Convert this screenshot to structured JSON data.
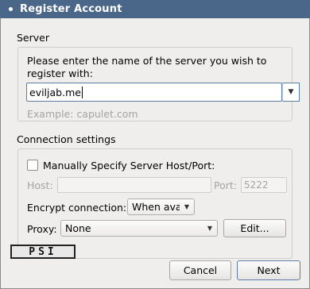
{
  "window": {
    "title": "Register Account"
  },
  "server_section": {
    "label": "Server",
    "prompt_line1": "Please enter the name of the server you wish to",
    "prompt_line2": "register with:",
    "server_value": "eviljab.me",
    "example": "Example: capulet.com"
  },
  "connection_section": {
    "label": "Connection settings",
    "manual_label": "Manually Specify Server Host/Port:",
    "manual_checked": false,
    "host_label": "Host:",
    "host_value": "",
    "port_label": "Port:",
    "port_placeholder": "5222",
    "encrypt_label": "Encrypt connection:",
    "encrypt_value": "When ava",
    "proxy_label": "Proxy:",
    "proxy_value": "None",
    "edit_button": "Edit..."
  },
  "footer": {
    "logo_text": "PSI",
    "cancel_button": "Cancel",
    "next_button": "Next"
  },
  "icons": {
    "dropdown": "chevron-down-icon",
    "window": "window-menu-icon"
  }
}
